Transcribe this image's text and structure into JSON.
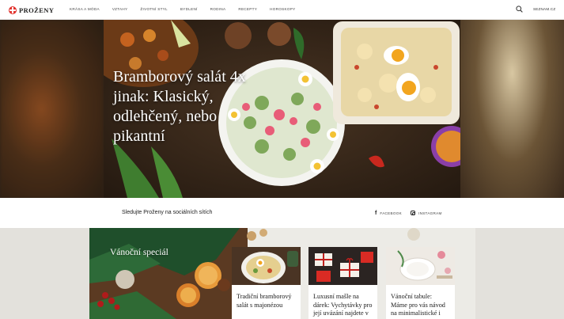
{
  "header": {
    "logo_text": "PROŽENY",
    "nav": [
      "KRÁSA A MÓDA",
      "VZTAHY",
      "ŽIVOTNÍ STYL",
      "BYDLENÍ",
      "RODINA",
      "RECEPTY",
      "HOROSKOPY"
    ],
    "search_icon": "search-icon",
    "seznam_link": "SEZNAM.CZ"
  },
  "hero": {
    "title": "Bramborový salát 4x jinak: Klasický, odlehčený, nebo pikantní"
  },
  "social": {
    "text": "Sledujte Proženy na sociálních sítích",
    "facebook_label": "FACEBOOK",
    "instagram_label": "INSTAGRAM"
  },
  "christmas": {
    "title": "Vánoční speciál",
    "cards": [
      {
        "title": "Tradiční bramborový salát s majonézou"
      },
      {
        "title": "Luxusní mašle na dárek: Vychytávky pro její uvázání najdete v kuchyni"
      },
      {
        "title": "Vánoční tabule: Máme pro vás návod na minimalistické i klasické prostírání"
      }
    ]
  },
  "colors": {
    "brand_red": "#e2342f",
    "section_bg": "#e3e1dc"
  }
}
